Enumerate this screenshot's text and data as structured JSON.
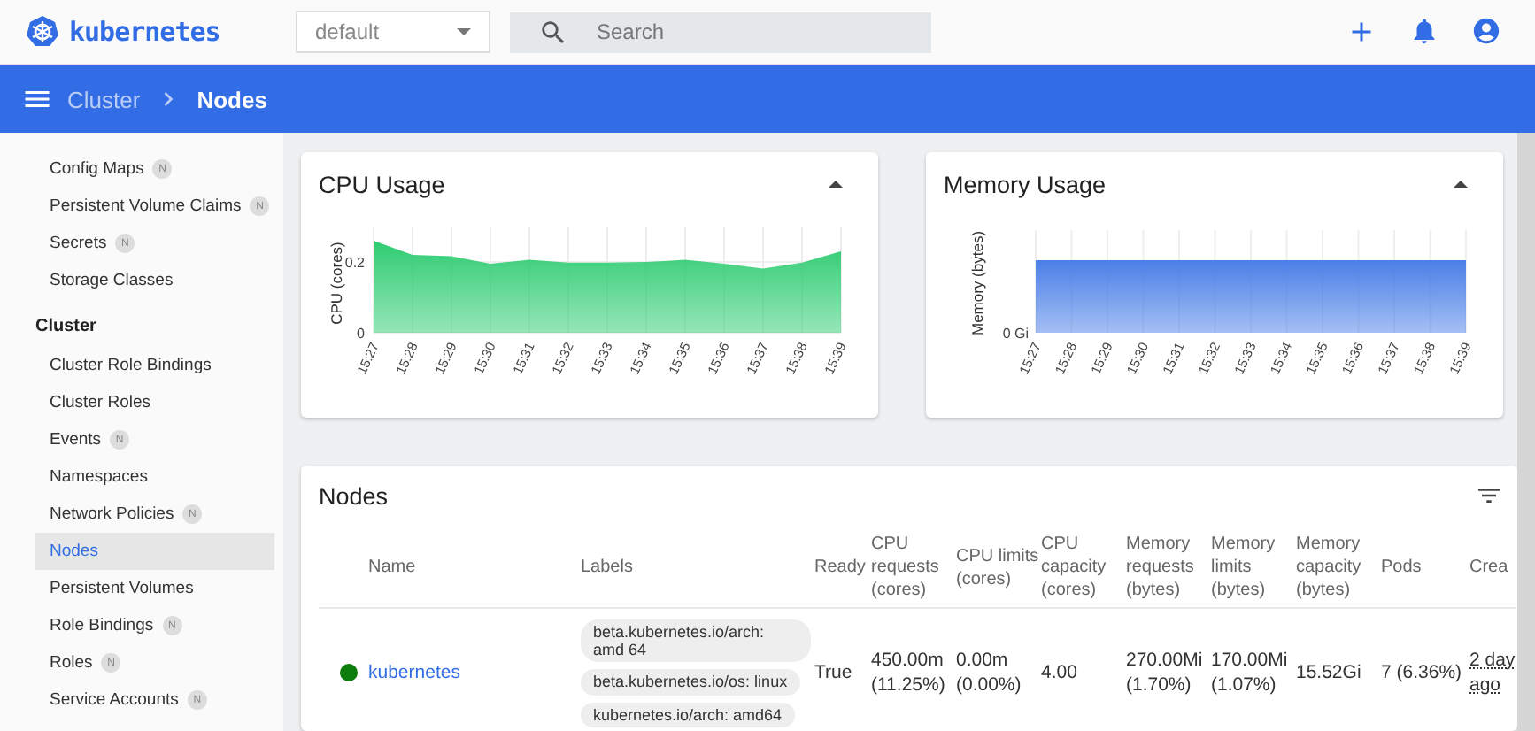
{
  "top_bar": {
    "logo": "kubernetes",
    "namespace": "default",
    "search": {
      "placeholder": "Search"
    }
  },
  "breadcrumb": [
    {
      "label": "Cluster",
      "current": false
    },
    {
      "label": "Nodes",
      "current": true
    }
  ],
  "sidebar": {
    "items": [
      {
        "kind": "item",
        "label": "Config Maps",
        "badge": "N",
        "selected": false
      },
      {
        "kind": "item",
        "label": "Persistent Volume Claims",
        "badge": "N",
        "selected": false
      },
      {
        "kind": "item",
        "label": "Secrets",
        "badge": "N",
        "selected": false
      },
      {
        "kind": "item",
        "label": "Storage Classes",
        "selected": false
      },
      {
        "kind": "header",
        "label": "Cluster"
      },
      {
        "kind": "item",
        "label": "Cluster Role Bindings",
        "selected": false
      },
      {
        "kind": "item",
        "label": "Cluster Roles",
        "selected": false
      },
      {
        "kind": "item",
        "label": "Events",
        "badge": "N",
        "selected": false
      },
      {
        "kind": "item",
        "label": "Namespaces",
        "selected": false
      },
      {
        "kind": "item",
        "label": "Network Policies",
        "badge": "N",
        "selected": false
      },
      {
        "kind": "item",
        "label": "Nodes",
        "selected": true
      },
      {
        "kind": "item",
        "label": "Persistent Volumes",
        "selected": false
      },
      {
        "kind": "item",
        "label": "Role Bindings",
        "badge": "N",
        "selected": false
      },
      {
        "kind": "item",
        "label": "Roles",
        "badge": "N",
        "selected": false
      },
      {
        "kind": "item",
        "label": "Service Accounts",
        "badge": "N",
        "selected": false
      }
    ]
  },
  "cpu_usage": {
    "title": "CPU Usage",
    "chart_data": {
      "type": "area",
      "ylabel": "CPU (cores)",
      "categories": [
        "15:27",
        "15:28",
        "15:29",
        "15:30",
        "15:31",
        "15:32",
        "15:33",
        "15:34",
        "15:35",
        "15:36",
        "15:37",
        "15:38",
        "15:39"
      ],
      "values": [
        0.26,
        0.22,
        0.216,
        0.195,
        0.206,
        0.198,
        0.198,
        0.2,
        0.206,
        0.195,
        0.181,
        0.198,
        0.23
      ],
      "ylim": [
        0,
        0.3
      ],
      "yticks": [
        0,
        0.2
      ],
      "grid": true
    }
  },
  "memory_usage": {
    "title": "Memory Usage",
    "ylabel": "Memory (bytes)",
    "y_tick": "0 Gi",
    "x_labels": [
      "15:27",
      "15:28",
      "15:29",
      "15:30",
      "15:31",
      "15:32",
      "15:33",
      "15:34",
      "15:35",
      "15:36",
      "15:37",
      "15:38",
      "15:39"
    ]
  },
  "nodes": {
    "title": "Nodes",
    "columns": [
      "Name",
      "Labels",
      "Ready",
      "CPU requests (cores)",
      "CPU limits (cores)",
      "CPU capacity (cores)",
      "Memory requests (bytes)",
      "Memory limits (bytes)",
      "Memory capacity (bytes)",
      "Pods",
      "Crea"
    ],
    "rows": [
      {
        "color": "#0b7d0b",
        "cells": [
          "kubernetes",
          [
            "beta.kubernetes.io/arch: amd 64",
            "beta.kubernetes.io/os: linux",
            "kubernetes.io/arch: amd64"
          ],
          "True",
          "450.00m (11.25%)",
          "0.00m (0.00%)",
          "4.00",
          "270.00Mi (1.70%)",
          "170.00Mi (1.07%)",
          "15.52Gi",
          "7 (6.36%)",
          "2 day ago"
        ]
      }
    ]
  }
}
